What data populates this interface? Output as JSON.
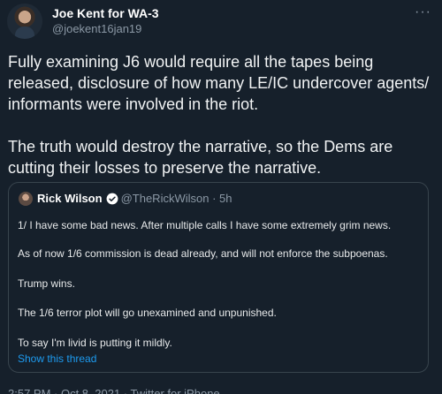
{
  "author": {
    "display_name": "Joe Kent for WA-3",
    "handle": "@joekent16jan19"
  },
  "menu_icon": "ellipsis-icon",
  "tweet_text": {
    "paragraph1": "Fully examining J6 would require all the tapes being released, disclosure of how many LE/IC undercover agents/ informants were involved in the riot.",
    "paragraph2": "The truth would destroy the narrative, so the Dems are cutting their losses to preserve the narrative."
  },
  "quoted_tweet": {
    "display_name": "Rick Wilson",
    "verified_icon": "verified-badge-icon",
    "meta": "@TheRickWilson · 5h",
    "lines": [
      "1/ I have some bad news. After multiple calls I have some extremely grim news.",
      "As of now 1/6 commission is dead already, and will not enforce the subpoenas.",
      "Trump wins.",
      "The 1/6 terror plot will go unexamined and unpunished.",
      "To say I'm livid is putting it mildly."
    ],
    "show_thread": "Show this thread"
  },
  "footer": {
    "timestamp": "2:57 PM · Oct 8, 2021 · Twitter for iPhone"
  },
  "colors": {
    "background": "#16202b",
    "link": "#1d9bf0",
    "muted": "#8b98a5"
  }
}
